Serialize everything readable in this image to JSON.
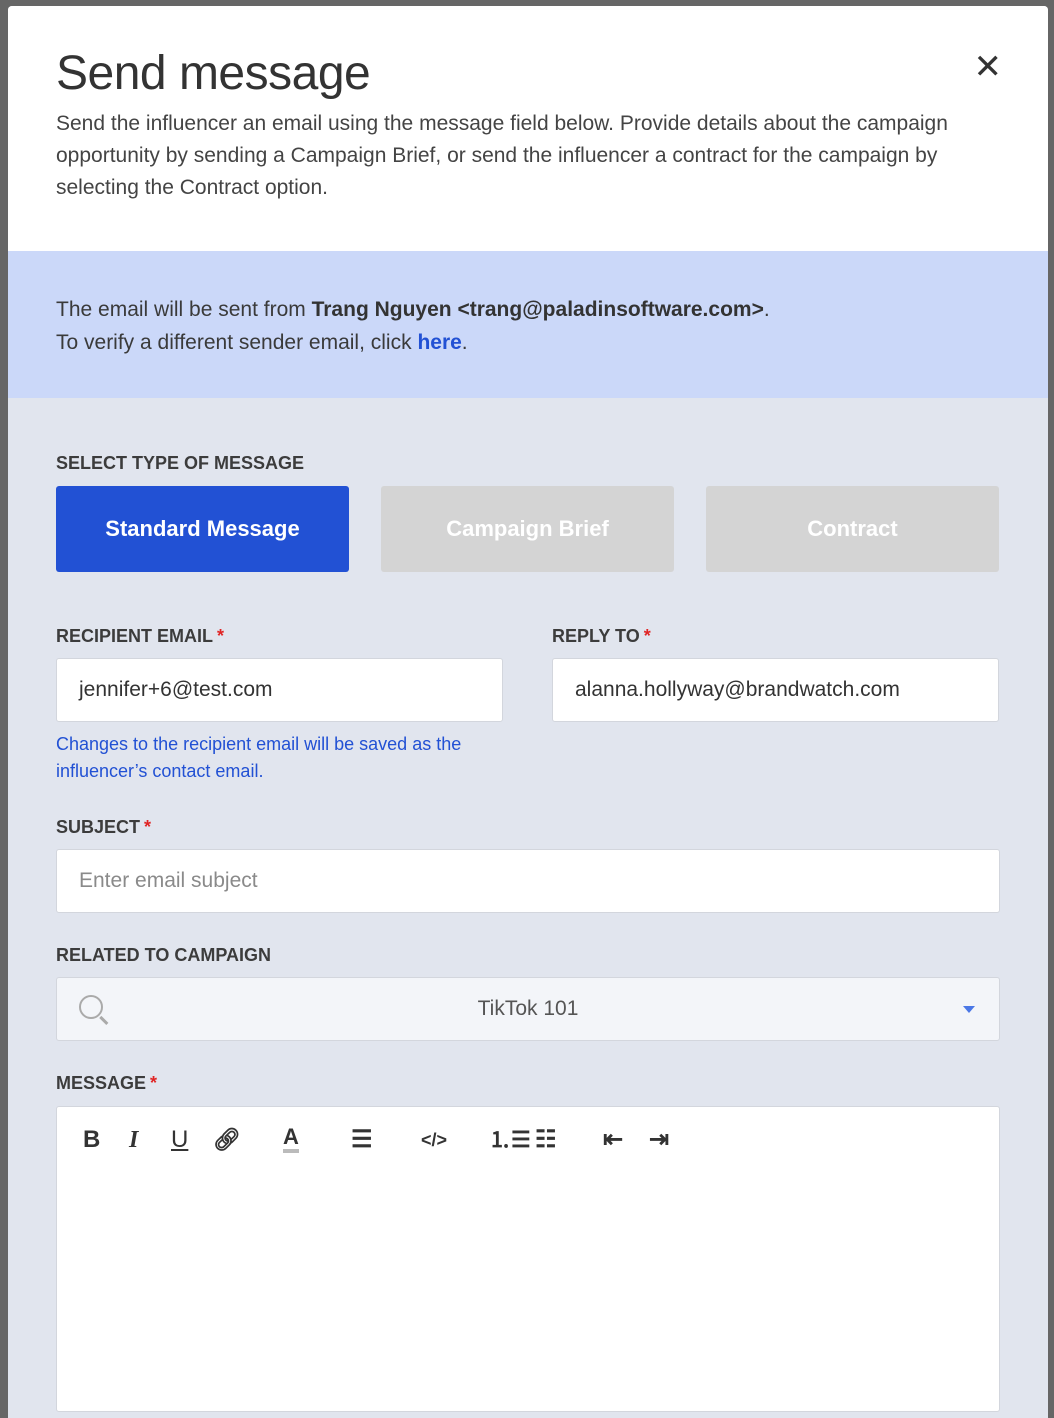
{
  "modal": {
    "title": "Send message",
    "description": "Send the influencer an email using the message field below. Provide details about the campaign opportunity by sending a Campaign Brief, or send the influencer a contract for the campaign by selecting the Contract option.",
    "close_icon": "close-icon"
  },
  "banner": {
    "prefix": "The email will be sent from ",
    "sender": "Trang Nguyen <trang@paladinsoftware.com>",
    "suffix": ".",
    "line2_prefix": "To verify a different sender email, click ",
    "link": "here",
    "line2_suffix": ".",
    "bg_color": "#cbd8f9"
  },
  "message_type": {
    "label": "SELECT TYPE OF MESSAGE",
    "options": [
      "Standard Message",
      "Campaign Brief",
      "Contract"
    ],
    "selected": "Standard Message",
    "accent": "#2251d4"
  },
  "recipient": {
    "label": "RECIPIENT EMAIL",
    "required": "*",
    "value": "jennifer+6@test.com",
    "hint": "Changes to the recipient email will be saved as the influencer’s contact email."
  },
  "reply_to": {
    "label": "REPLY TO",
    "required": "*",
    "value": "alanna.hollyway@brandwatch.com"
  },
  "subject": {
    "label": "SUBJECT",
    "required": "*",
    "value": "",
    "placeholder": "Enter email subject"
  },
  "campaign": {
    "label": "RELATED TO CAMPAIGN",
    "value": "TikTok 101"
  },
  "message": {
    "label": "MESSAGE",
    "required": "*",
    "value": "",
    "toolbar": [
      "bold",
      "italic",
      "underline",
      "link",
      "text-color",
      "align-left",
      "code",
      "ordered-list",
      "bullet-list",
      "outdent",
      "indent"
    ]
  }
}
